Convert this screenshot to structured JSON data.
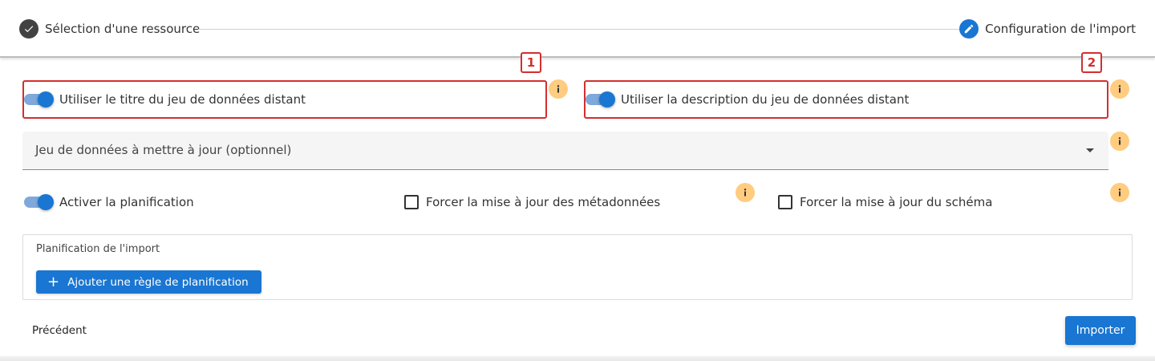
{
  "stepper": {
    "steps": [
      {
        "label": "Sélection d'une ressource",
        "state": "done",
        "icon": "check-icon"
      },
      {
        "label": "Configuration de l'import",
        "state": "active",
        "icon": "pencil-icon"
      }
    ]
  },
  "annotations": [
    "1",
    "2"
  ],
  "options": {
    "use_remote_title": {
      "label": "Utiliser le titre du jeu de données distant",
      "on": true
    },
    "use_remote_description": {
      "label": "Utiliser la description du jeu de données distant",
      "on": true
    },
    "enable_planning": {
      "label": "Activer la planification",
      "on": true
    },
    "force_metadata_update": {
      "label": "Forcer la mise à jour des métadonnées",
      "checked": false
    },
    "force_schema_update": {
      "label": "Forcer la mise à jour du schéma",
      "checked": false
    }
  },
  "dataset_select": {
    "label": "Jeu de données à mettre à jour (optionnel)"
  },
  "planning": {
    "title": "Planification de l'import",
    "add_rule_label": "Ajouter une règle de planification"
  },
  "actions": {
    "previous_label": "Précédent",
    "import_label": "Importer"
  },
  "colors": {
    "primary": "#1976d2",
    "annotation": "#d32f2f",
    "info": "#ffcc80",
    "done_step": "#424242"
  }
}
